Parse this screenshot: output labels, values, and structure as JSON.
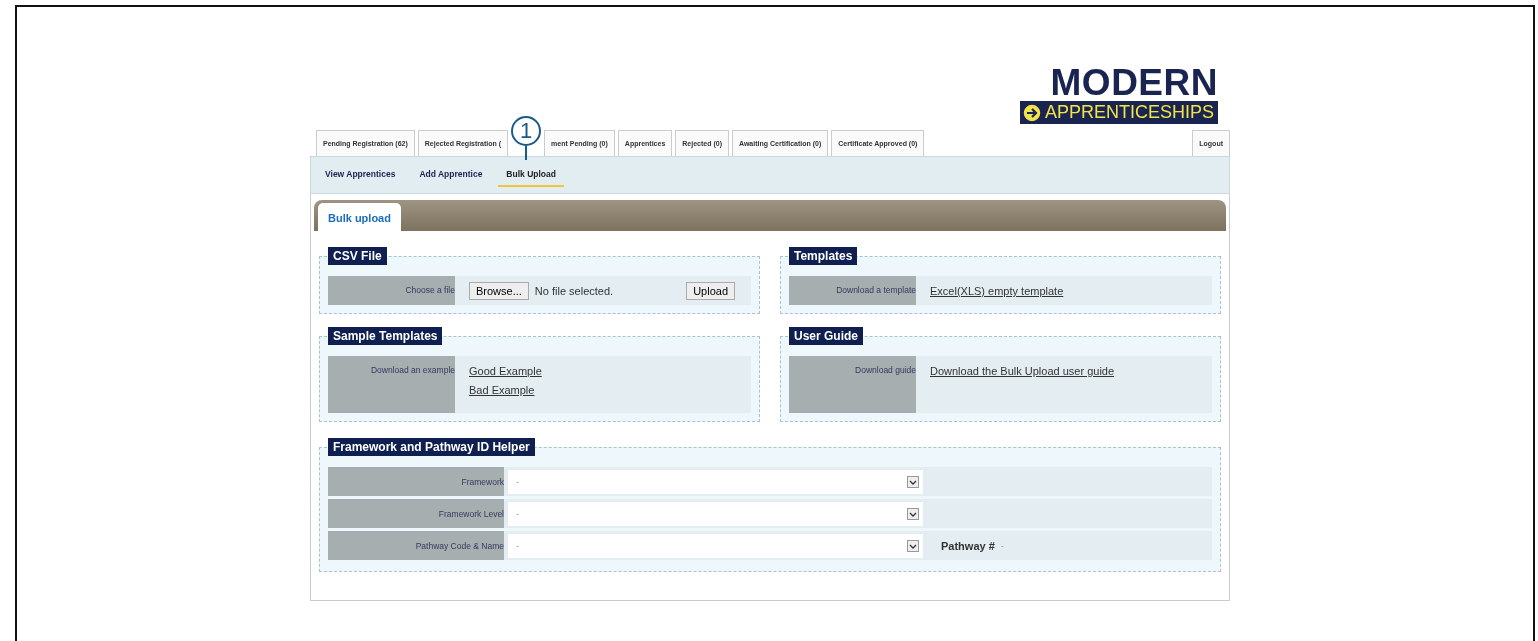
{
  "logo": {
    "line1": "MODERN",
    "line2": "APPRENTICESHIPS"
  },
  "tabs": [
    {
      "label": "Pending Registration (62)",
      "selected": false
    },
    {
      "label": "Rejected Registration (",
      "selected": false
    },
    {
      "label": "ment Pending (0)",
      "selected": false
    },
    {
      "label": "Apprentices",
      "selected": false
    },
    {
      "label": "Rejected (0)",
      "selected": false
    },
    {
      "label": "Awaiting Certification (0)",
      "selected": false
    },
    {
      "label": "Certificate Approved (0)",
      "selected": false
    }
  ],
  "logout": "Logout",
  "subnav": [
    {
      "label": "View Apprentices",
      "selected": false
    },
    {
      "label": "Add Apprentice",
      "selected": false
    },
    {
      "label": "Bulk Upload",
      "selected": true
    }
  ],
  "callout": {
    "number": "1"
  },
  "panel_tab": "Bulk upload",
  "csv_file": {
    "title": "CSV File",
    "label": "Choose a file",
    "browse": "Browse...",
    "file_status": "No file selected.",
    "upload": "Upload"
  },
  "templates": {
    "title": "Templates",
    "label": "Download a template",
    "links": [
      "Excel(XLS) empty template"
    ]
  },
  "sample_templates": {
    "title": "Sample Templates",
    "label": "Download an example",
    "links": [
      "Good Example",
      "Bad Example"
    ]
  },
  "user_guide": {
    "title": "User Guide",
    "label": "Download guide",
    "links": [
      "Download the Bulk Upload user guide"
    ]
  },
  "helper": {
    "title": "Framework and Pathway ID Helper",
    "rows": [
      {
        "label": "Framework",
        "value": "-"
      },
      {
        "label": "Framework Level",
        "value": "-"
      },
      {
        "label": "Pathway Code & Name",
        "value": "-",
        "extra_label": "Pathway #",
        "extra_value": "-"
      }
    ]
  }
}
